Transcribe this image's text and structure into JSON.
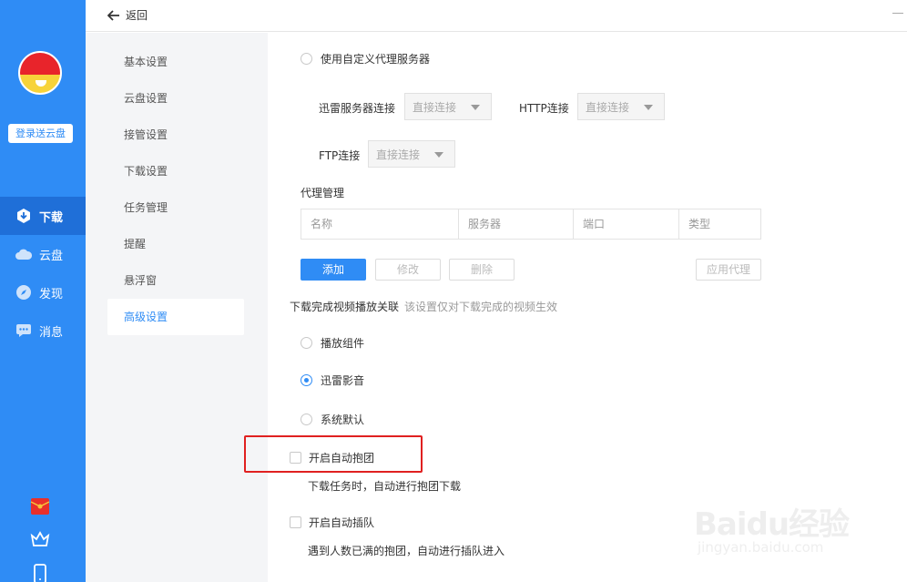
{
  "topbar": {
    "back_label": "返回"
  },
  "rail": {
    "login_label": "登录送云盘",
    "nav": [
      {
        "label": "下载",
        "icon": "download-icon",
        "active": true
      },
      {
        "label": "云盘",
        "icon": "cloud-icon",
        "active": false
      },
      {
        "label": "发现",
        "icon": "compass-icon",
        "active": false
      },
      {
        "label": "消息",
        "icon": "message-icon",
        "active": false
      }
    ],
    "bottom_icons": [
      "red-envelope-icon",
      "crown-icon",
      "phone-icon"
    ]
  },
  "settings_nav": {
    "items": [
      "基本设置",
      "云盘设置",
      "接管设置",
      "下载设置",
      "任务管理",
      "提醒",
      "悬浮窗",
      "高级设置"
    ],
    "active_index": 7
  },
  "proxy": {
    "custom_proxy_label": "使用自定义代理服务器",
    "thunder_conn_label": "迅雷服务器连接",
    "thunder_conn_value": "直接连接",
    "http_label": "HTTP连接",
    "http_value": "直接连接",
    "ftp_label": "FTP连接",
    "ftp_value": "直接连接",
    "manage_title": "代理管理",
    "columns": [
      "名称",
      "服务器",
      "端口",
      "类型"
    ],
    "add_label": "添加",
    "edit_label": "修改",
    "delete_label": "删除",
    "apply_label": "应用代理"
  },
  "video_assoc": {
    "title": "下载完成视频播放关联",
    "hint": "该设置仅对下载完成的视频生效",
    "options": [
      "播放组件",
      "迅雷影音",
      "系统默认"
    ],
    "selected_index": 1
  },
  "auto_group": {
    "label": "开启自动抱团",
    "desc": "下载任务时，自动进行抱团下载"
  },
  "auto_queue": {
    "label": "开启自动插队",
    "desc": "遇到人数已满的抱团，自动进行插队进入"
  },
  "watermark": {
    "main": "Baidu经验",
    "sub": "jingyan.baidu.com"
  },
  "colors": {
    "accent": "#2f8cf5",
    "rail": "#2f8cf5",
    "highlight": "#e02020"
  }
}
